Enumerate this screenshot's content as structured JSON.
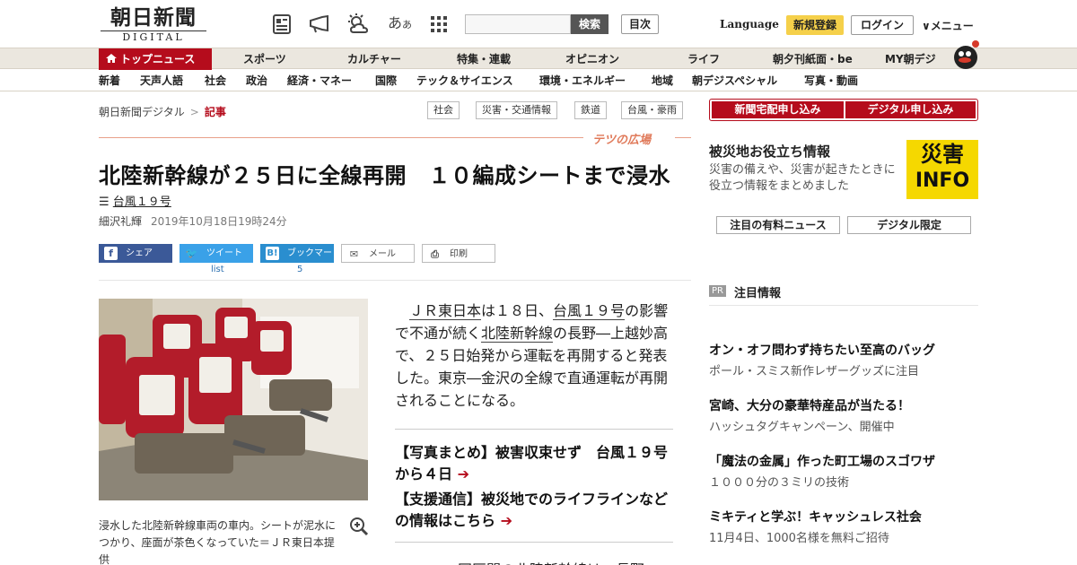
{
  "header": {
    "logo_text": "朝日新聞",
    "logo_sub": "DIGITAL",
    "font_size_label": "あ",
    "font_size_small": "あ",
    "search_placeholder": "",
    "search_button": "検索",
    "toc_button": "目次",
    "language": "Language",
    "signup": "新規登録",
    "login": "ログイン",
    "menu": "∨メニュー"
  },
  "nav_primary": [
    {
      "label": "トップニュース",
      "active": true
    },
    {
      "label": "スポーツ"
    },
    {
      "label": "カルチャー"
    },
    {
      "label": "特集・連載"
    },
    {
      "label": "オピニオン"
    },
    {
      "label": "ライフ"
    },
    {
      "label": "朝夕刊紙面・be"
    },
    {
      "label": "MY朝デジ"
    }
  ],
  "nav_secondary": [
    "新着",
    "天声人語",
    "社会",
    "政治",
    "経済・マネー",
    "国際",
    "テック＆サイエンス",
    "環境・エネルギー",
    "地域",
    "朝デジスペシャル",
    "写真・動画"
  ],
  "breadcrumb": {
    "home": "朝日新聞デジタル",
    "sep": ">",
    "current": "記事"
  },
  "tags": [
    "社会",
    "災害・交通情報",
    "鉄道",
    "台風・豪雨"
  ],
  "section_logo": "テツの広場",
  "article": {
    "headline": "北陸新幹線が２５日に全線再開　１０編成シートまで浸水",
    "topic_icon": "list-icon",
    "topic": "台風１９号",
    "author": "細沢礼輝",
    "date": "2019年10月18日19時24分",
    "share": {
      "facebook": "シェア",
      "twitter": "ツイート",
      "twitter_count": "list",
      "hatena": "ブックマーク",
      "hatena_count": "5",
      "mail": "メール",
      "print": "印刷"
    },
    "photo_caption": "浸水した北陸新幹線車両の車内。シートが泥水につかり、座面が茶色くなっていた＝ＪＲ東日本提供",
    "body_p1_a": "ＪＲ東日本",
    "body_p1_b": "は１８日、",
    "body_p1_c": "台風１９号",
    "body_p1_d": "の影響で不通が続く",
    "body_p1_e": "北陸新幹線",
    "body_p1_f": "の長野―上越妙高で、２５日始発から運転を再開すると発表した。東京―金沢の全線で直通運転が再開されることになる。",
    "related": [
      "【写真まとめ】被害収束せず　台風１９号から４日",
      "【支援通信】被災地でのライフラインなどの情報はこちら"
    ],
    "body_cut": "同区間の北陸新幹線は、長野"
  },
  "sidebar": {
    "sub_newspaper": "新聞宅配申し込み",
    "sub_digital": "デジタル申し込み",
    "disaster_title": "被災地お役立ち情報",
    "disaster_desc": "災害の備えや、災害が起きたときに役立つ情報をまとめました",
    "saigai_1": "災害",
    "saigai_2": "INFO",
    "btn_paid": "注目の有料ニュース",
    "btn_digital": "デジタル限定",
    "pr_label": "PR",
    "pr_title": "注目情報",
    "pr_items": [
      {
        "title": "オン・オフ問わず持ちたい至高のバッグ",
        "sub": "ポール・スミス新作レザーグッズに注目"
      },
      {
        "title": "宮崎、大分の豪華特産品が当たる！",
        "sub": "ハッシュタグキャンペーン、開催中"
      },
      {
        "title": "「魔法の金属」作った町工場のスゴワザ",
        "sub": "１０００分の３ミリの技術"
      },
      {
        "title": "ミキティと学ぶ！キャッシュレス社会",
        "sub": "11月4日、1000名様を無料ご招待"
      }
    ],
    "pr_cut": ""
  },
  "colors": {
    "brand_red": "#b50c1c",
    "signup_yellow": "#f5d04a",
    "nav_bg": "#ebe7df",
    "saigai_yellow": "#f5d800"
  }
}
